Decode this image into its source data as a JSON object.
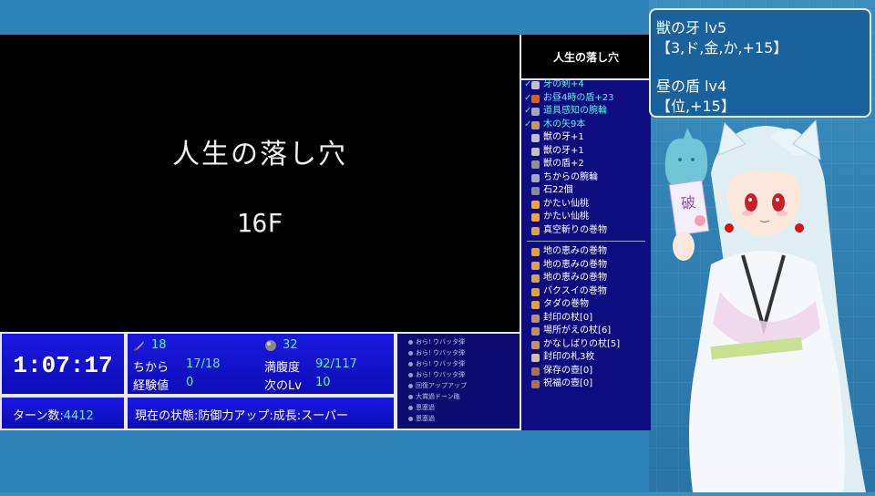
{
  "game": {
    "dungeon_name": "人生の落し穴",
    "floor": "16F"
  },
  "timer": "1:07:17",
  "turns": {
    "label": "ターン数:",
    "value": "4412"
  },
  "stats": {
    "attack": "18",
    "defense": "32",
    "strength_label": "ちから",
    "strength_value": "17/18",
    "fullness_label": "満腹度",
    "fullness_value": "92/117",
    "exp_label": "経験値",
    "exp_value": "0",
    "nextlv_label": "次のLv",
    "nextlv_value": "10"
  },
  "state": "現在の状態:防御力アップ:成長:スーパー",
  "log": [
    "おら! ウバッタ弾",
    "おら! ウバッタ弾",
    "おら! ウバッタ弾",
    "おら! ウバッタ弾",
    "回復アップアップ",
    "大賞過ドーン砲",
    "恩塞過",
    "恩塞過"
  ],
  "inventory": {
    "title": "人生の落し穴",
    "items_top": [
      {
        "name": "牙の剣+4",
        "equipped": true,
        "icon": "sword-icon",
        "color": "#c0c0c0"
      },
      {
        "name": "お昼4時の盾+23",
        "equipped": true,
        "icon": "shield-icon",
        "color": "#d86020"
      },
      {
        "name": "道具感知の腕輪",
        "equipped": true,
        "icon": "bracelet-icon",
        "color": "#a0a8c0"
      },
      {
        "name": "木の矢9本",
        "equipped": true,
        "icon": "arrow-icon",
        "color": "#c89858"
      },
      {
        "name": "獣の牙+1",
        "equipped": false,
        "icon": "sword-icon",
        "color": "#c0c0c0"
      },
      {
        "name": "獣の牙+1",
        "equipped": false,
        "icon": "sword-icon",
        "color": "#c0c0c0"
      },
      {
        "name": "獣の盾+2",
        "equipped": false,
        "icon": "shield-icon",
        "color": "#909090"
      },
      {
        "name": "ちからの腕輪",
        "equipped": false,
        "icon": "bracelet-icon",
        "color": "#a0a8c0"
      },
      {
        "name": "石22個",
        "equipped": false,
        "icon": "stone-icon",
        "color": "#8a8a8a"
      },
      {
        "name": "かたい仙桃",
        "equipped": false,
        "icon": "peach-icon",
        "color": "#f0a040"
      },
      {
        "name": "かたい仙桃",
        "equipped": false,
        "icon": "peach-icon",
        "color": "#f0a040"
      },
      {
        "name": "真空斬りの巻物",
        "equipped": false,
        "icon": "scroll-icon",
        "color": "#e0a040"
      }
    ],
    "items_bottom": [
      {
        "name": "地の恵みの巻物",
        "icon": "scroll-icon",
        "color": "#e0a040"
      },
      {
        "name": "地の恵みの巻物",
        "icon": "scroll-icon",
        "color": "#e0a040"
      },
      {
        "name": "地の恵みの巻物",
        "icon": "scroll-icon",
        "color": "#e0a040"
      },
      {
        "name": "バクスイの巻物",
        "icon": "scroll-icon",
        "color": "#e0a040"
      },
      {
        "name": "タダの巻物",
        "icon": "scroll-icon",
        "color": "#e0a040"
      },
      {
        "name": "封印の杖[0]",
        "icon": "staff-icon",
        "color": "#c09060"
      },
      {
        "name": "場所がえの杖[6]",
        "icon": "staff-icon",
        "color": "#c09060"
      },
      {
        "name": "かなしばりの杖[5]",
        "icon": "staff-icon",
        "color": "#c09060"
      },
      {
        "name": "封印の札3枚",
        "icon": "talisman-icon",
        "color": "#d0c0a0"
      },
      {
        "name": "保存の壺[0]",
        "icon": "pot-icon",
        "color": "#b07040"
      },
      {
        "name": "祝福の壺[0]",
        "icon": "pot-icon",
        "color": "#b07040"
      }
    ]
  },
  "info": {
    "line1": "獣の牙  lv5",
    "line2": "【3,ド,金,か,+15】",
    "line3": "昼の盾  lv4",
    "line4": "【位,+15】"
  },
  "colors": {
    "panel_blue": "#1010d0",
    "value_cyan": "#5ff0e8",
    "background": "#3b8fbf"
  }
}
